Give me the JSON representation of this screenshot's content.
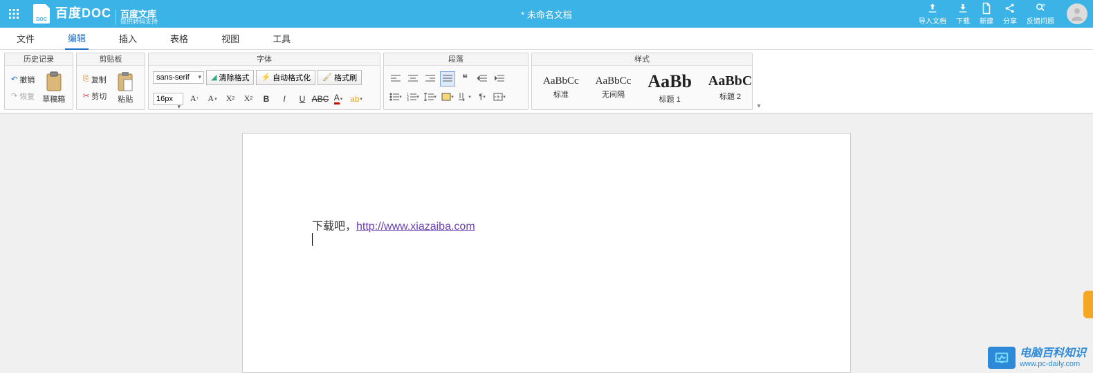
{
  "header": {
    "brand_main": "百度DOC",
    "brand_sub_top": "百度文库",
    "brand_sub_bottom": "提供转码支持",
    "doc_title": "* 未命名文档",
    "actions": {
      "import": "导入文档",
      "download": "下载",
      "new": "新建",
      "share": "分享",
      "feedback": "反馈问题"
    }
  },
  "menu": {
    "file": "文件",
    "edit": "编辑",
    "insert": "插入",
    "table": "表格",
    "view": "视图",
    "tools": "工具"
  },
  "ribbon": {
    "history": {
      "title": "历史记录",
      "undo": "撤销",
      "redo": "恢复",
      "drafts": "草稿箱"
    },
    "clipboard": {
      "title": "剪贴板",
      "copy": "复制",
      "cut": "剪切",
      "paste": "粘贴"
    },
    "font": {
      "title": "字体",
      "family": "sans-serif",
      "clear_format": "清除格式",
      "auto_format": "自动格式化",
      "format_painter": "格式刷",
      "size": "16px"
    },
    "paragraph": {
      "title": "段落"
    },
    "styles": {
      "title": "样式",
      "items": [
        {
          "preview": "AaBbCc",
          "label": "标准",
          "size": "15px",
          "weight": "normal"
        },
        {
          "preview": "AaBbCc",
          "label": "无间隔",
          "size": "15px",
          "weight": "normal"
        },
        {
          "preview": "AaBb",
          "label": "标题 1",
          "size": "26px",
          "weight": "bold"
        },
        {
          "preview": "AaBbC",
          "label": "标题 2",
          "size": "20px",
          "weight": "bold"
        }
      ]
    }
  },
  "document": {
    "text_prefix": "下载吧，",
    "link_text": "http://www.xiazaiba.com"
  },
  "watermark": {
    "cn": "电脑百科知识",
    "en": "www.pc-daily.com"
  }
}
